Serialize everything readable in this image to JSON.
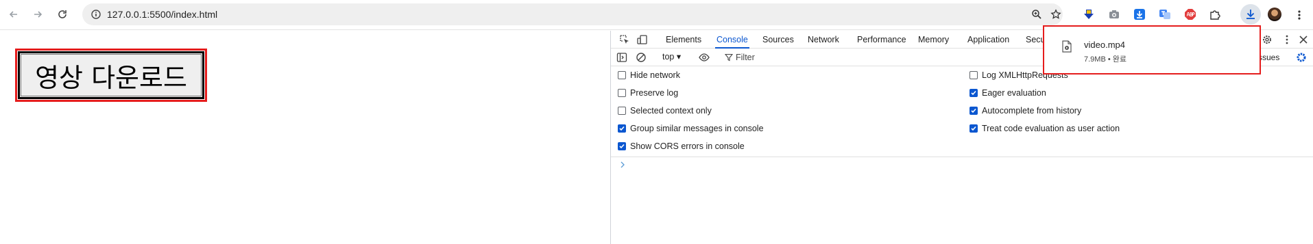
{
  "browser": {
    "url": "127.0.0.1:5500/index.html"
  },
  "page": {
    "download_button_label": "영상 다운로드"
  },
  "devtools": {
    "tabs": [
      "Elements",
      "Console",
      "Sources",
      "Network",
      "Performance",
      "Memory",
      "Application",
      "Secu"
    ],
    "active_tab": "Console",
    "context": "top",
    "filter_placeholder": "Filter",
    "issues_label": "ssues",
    "settings_left": [
      {
        "label": "Hide network",
        "checked": false
      },
      {
        "label": "Preserve log",
        "checked": false
      },
      {
        "label": "Selected context only",
        "checked": false
      },
      {
        "label": "Group similar messages in console",
        "checked": true
      },
      {
        "label": "Show CORS errors in console",
        "checked": true
      }
    ],
    "settings_right": [
      {
        "label": "Log XMLHttpRequests",
        "checked": false
      },
      {
        "label": "Eager evaluation",
        "checked": true
      },
      {
        "label": "Autocomplete from history",
        "checked": true
      },
      {
        "label": "Treat code evaluation as user action",
        "checked": true
      }
    ]
  },
  "download": {
    "file_name": "video.mp4",
    "status": "7.9MB • 완료"
  },
  "colors": {
    "accent": "#0b57d0",
    "highlight": "#e51c1c"
  }
}
